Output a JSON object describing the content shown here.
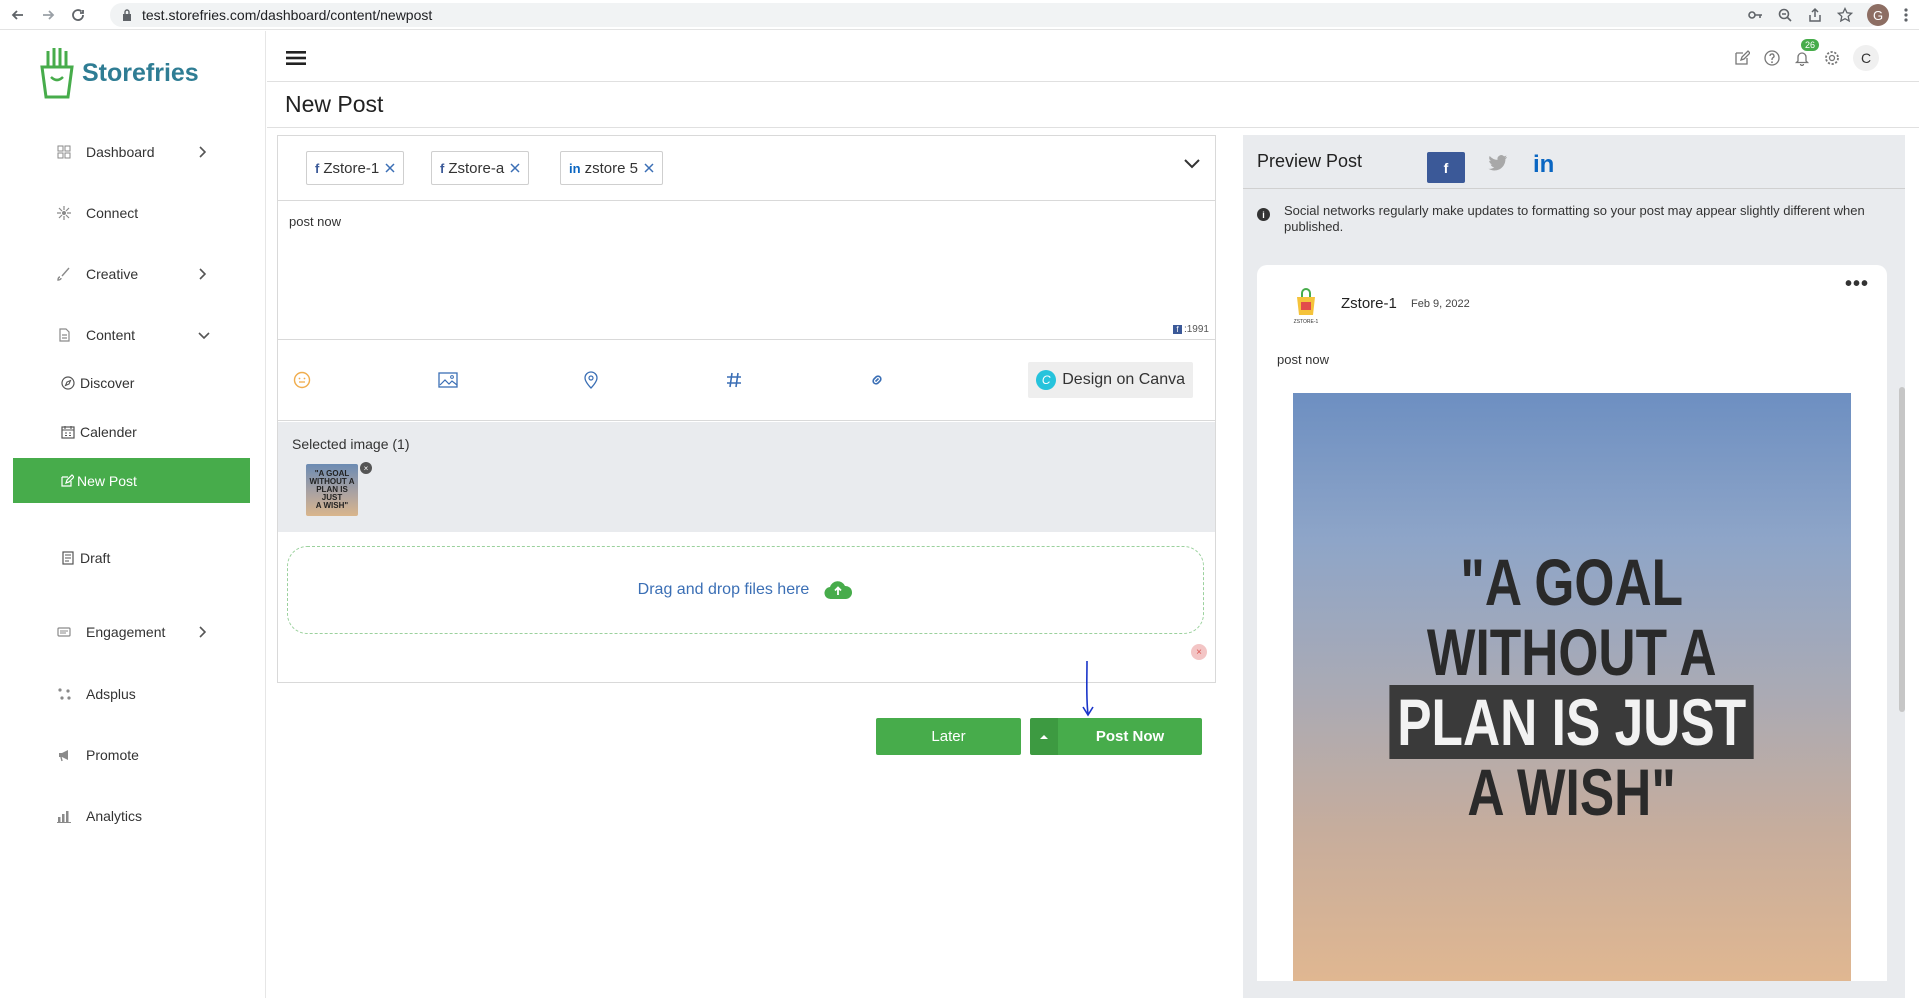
{
  "browser": {
    "url": "test.storefries.com/dashboard/content/newpost",
    "profile_initial": "G"
  },
  "brand": {
    "name": "Storefries",
    "color": "#47ac4b"
  },
  "sidebar": {
    "items": [
      {
        "label": "Dashboard"
      },
      {
        "label": "Connect"
      },
      {
        "label": "Creative"
      },
      {
        "label": "Content"
      },
      {
        "label": "Engagement"
      },
      {
        "label": "Adsplus"
      },
      {
        "label": "Promote"
      },
      {
        "label": "Analytics"
      }
    ],
    "content_sub": [
      {
        "label": "Discover"
      },
      {
        "label": "Calender"
      },
      {
        "label": "New Post"
      },
      {
        "label": "Draft"
      }
    ]
  },
  "header": {
    "notifications": "26",
    "user_initial": "C"
  },
  "page": {
    "title": "New Post"
  },
  "composer": {
    "accounts": [
      {
        "network": "f",
        "name": "Zstore-1"
      },
      {
        "network": "f",
        "name": "Zstore-a"
      },
      {
        "network": "in",
        "name": "zstore 5"
      }
    ],
    "text": "post now",
    "char_count": ":1991",
    "canva_label": "Design on Canva",
    "selected_label": "Selected image (1)",
    "dropzone_label": "Drag and drop files here",
    "later_label": "Later",
    "post_now_label": "Post Now"
  },
  "preview": {
    "title": "Preview Post",
    "note": "Social networks regularly make updates to formatting so your post may appear slightly different when published.",
    "card": {
      "name": "Zstore-1",
      "date": "Feb 9, 2022",
      "avatar_caption": "ZSTORE-1",
      "text": "post now",
      "image_lines": [
        "\"A GOAL",
        "WITHOUT A",
        "PLAN IS JUST",
        "A WISH\""
      ]
    }
  }
}
